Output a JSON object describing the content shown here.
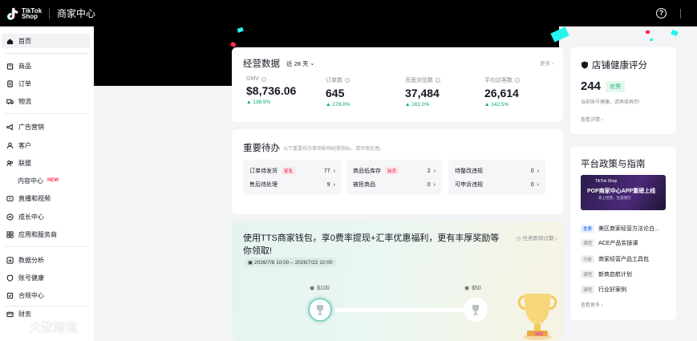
{
  "header": {
    "logo_text_1": "TikTok",
    "logo_text_2": "Shop",
    "title": "商家中心"
  },
  "sidebar": {
    "items": [
      {
        "label": "首页",
        "icon": "home-icon"
      },
      {
        "label": "商品",
        "icon": "product-icon"
      },
      {
        "label": "订单",
        "icon": "order-icon"
      },
      {
        "label": "物流",
        "icon": "truck-icon"
      },
      {
        "label": "广告营销",
        "icon": "megaphone-icon"
      },
      {
        "label": "客户",
        "icon": "customer-icon"
      },
      {
        "label": "联盟",
        "icon": "affiliate-icon"
      },
      {
        "label": "内容中心",
        "badge": "NEW"
      },
      {
        "label": "直播和视频",
        "icon": "video-icon"
      },
      {
        "label": "成长中心",
        "icon": "growth-icon"
      },
      {
        "label": "应用和服务商",
        "icon": "apps-icon"
      },
      {
        "label": "数据分析",
        "icon": "chart-icon"
      },
      {
        "label": "账号健康",
        "icon": "shield-check-icon"
      },
      {
        "label": "合规中心",
        "icon": "compliance-icon"
      },
      {
        "label": "财务",
        "icon": "wallet-icon"
      }
    ]
  },
  "business_data": {
    "title": "经营数据",
    "period": "近 28 天",
    "more": "更多",
    "metrics": [
      {
        "label": "GMV",
        "value": "$8,736.06",
        "delta": "138.9%"
      },
      {
        "label": "订单数",
        "value": "645",
        "delta": "178.0%"
      },
      {
        "label": "页面浏览数",
        "value": "37,484",
        "delta": "161.0%"
      },
      {
        "label": "平均访客数",
        "value": "26,614",
        "delta": "142.5%"
      }
    ]
  },
  "todos": {
    "title": "重要待办",
    "subtitle": "以下重要待办事项影响经营指标，请尽快处理。",
    "items": [
      {
        "label": "订单待发货",
        "tag": "紧急",
        "count": "77"
      },
      {
        "label": "售后待处理",
        "count": "9"
      },
      {
        "label": "商品低库存",
        "tag": "缺货",
        "count": "2"
      },
      {
        "label": "被拒商品",
        "count": "0"
      },
      {
        "label": "待整改违规",
        "count": "0"
      },
      {
        "label": "可申诉违规",
        "count": "0"
      }
    ]
  },
  "promo": {
    "title": "使用TTS商家钱包，享0费率提现+汇率优惠福利，更有丰厚奖励等你领取!",
    "date_range": "2026/7/8 10:00 – 2026/7/22 10:00",
    "expiry_link": "任务即将过期",
    "rewards": [
      "$100",
      "$50"
    ]
  },
  "shop_health": {
    "title": "店铺健康评分",
    "score": "244",
    "rating": "优秀",
    "desc": "当前账号健康，请再接再厉!",
    "link": "查看详情"
  },
  "policy": {
    "title": "平台政策与指南",
    "banner_brand": "TikTok Shop",
    "banner_title": "POP商家中心APP重磅上线",
    "banner_sub": "掌上经营，生意随行",
    "items": [
      {
        "tag": "重要",
        "label": "美区商家经营方法论白..."
      },
      {
        "tag": "课程",
        "label": "ACE产品实操课"
      },
      {
        "tag": "功能",
        "label": "商家经营产品工具包"
      },
      {
        "tag": "课程",
        "label": "新商启航计划"
      },
      {
        "tag": "课程",
        "label": "行业好案例"
      }
    ],
    "more": "查看更多"
  },
  "watermark": {
    "text": "大数跨境"
  },
  "colors": {
    "accent_green": "#00a86b",
    "tiktok_red": "#fe2c55",
    "tiktok_cyan": "#25f4ee",
    "excellent_green": "#1fb57b"
  }
}
